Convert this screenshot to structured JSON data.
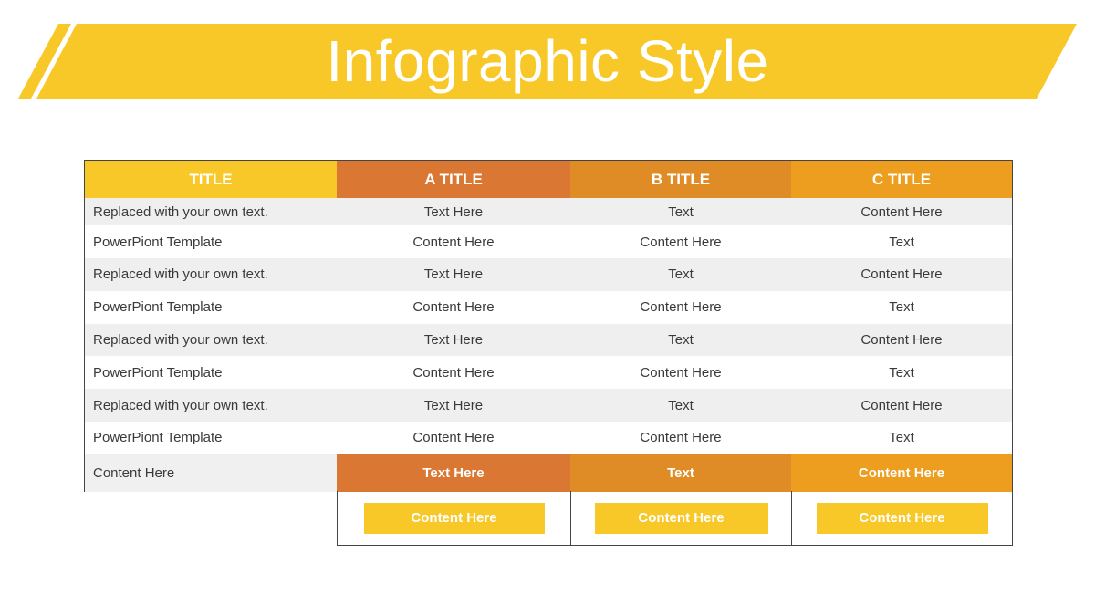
{
  "title": "Infographic Style",
  "colors": {
    "banner": "#f8c829",
    "title_col": "#f8c829",
    "col_a": "#d97733",
    "col_b": "#df8c26",
    "col_c": "#ed9e1f",
    "row_shade": "#efefef",
    "button": "#f8c829"
  },
  "table": {
    "headers": [
      "TITLE",
      "A TITLE",
      "B TITLE",
      "C TITLE"
    ],
    "rows": [
      [
        "Replaced with your own text.",
        "Text  Here",
        "Text",
        "Content Here"
      ],
      [
        "PowerPiont Template",
        "Content Here",
        "Content Here",
        "Text"
      ],
      [
        "Replaced with your own text.",
        "Text  Here",
        "Text",
        "Content Here"
      ],
      [
        "PowerPiont Template",
        "Content Here",
        "Content Here",
        "Text"
      ],
      [
        "Replaced with your own text.",
        "Text  Here",
        "Text",
        "Content Here"
      ],
      [
        "PowerPiont Template",
        "Content Here",
        "Content Here",
        "Text"
      ],
      [
        "Replaced with your own text.",
        "Text  Here",
        "Text",
        "Content Here"
      ],
      [
        "PowerPiont Template",
        "Content Here",
        "Content Here",
        "Text"
      ]
    ],
    "footer": [
      "Content Here",
      "Text Here",
      "Text",
      "Content Here"
    ]
  },
  "buttons": [
    "Content Here",
    "Content Here",
    "Content Here"
  ]
}
